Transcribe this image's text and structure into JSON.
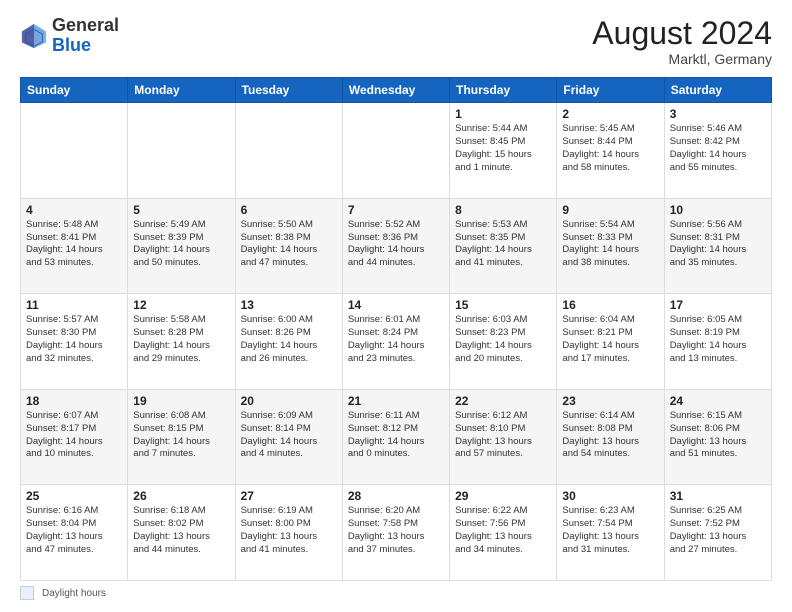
{
  "header": {
    "logo_general": "General",
    "logo_blue": "Blue",
    "month_year": "August 2024",
    "location": "Marktl, Germany"
  },
  "calendar": {
    "days_of_week": [
      "Sunday",
      "Monday",
      "Tuesday",
      "Wednesday",
      "Thursday",
      "Friday",
      "Saturday"
    ],
    "weeks": [
      [
        {
          "day": "",
          "info": ""
        },
        {
          "day": "",
          "info": ""
        },
        {
          "day": "",
          "info": ""
        },
        {
          "day": "",
          "info": ""
        },
        {
          "day": "1",
          "info": "Sunrise: 5:44 AM\nSunset: 8:45 PM\nDaylight: 15 hours\nand 1 minute."
        },
        {
          "day": "2",
          "info": "Sunrise: 5:45 AM\nSunset: 8:44 PM\nDaylight: 14 hours\nand 58 minutes."
        },
        {
          "day": "3",
          "info": "Sunrise: 5:46 AM\nSunset: 8:42 PM\nDaylight: 14 hours\nand 55 minutes."
        }
      ],
      [
        {
          "day": "4",
          "info": "Sunrise: 5:48 AM\nSunset: 8:41 PM\nDaylight: 14 hours\nand 53 minutes."
        },
        {
          "day": "5",
          "info": "Sunrise: 5:49 AM\nSunset: 8:39 PM\nDaylight: 14 hours\nand 50 minutes."
        },
        {
          "day": "6",
          "info": "Sunrise: 5:50 AM\nSunset: 8:38 PM\nDaylight: 14 hours\nand 47 minutes."
        },
        {
          "day": "7",
          "info": "Sunrise: 5:52 AM\nSunset: 8:36 PM\nDaylight: 14 hours\nand 44 minutes."
        },
        {
          "day": "8",
          "info": "Sunrise: 5:53 AM\nSunset: 8:35 PM\nDaylight: 14 hours\nand 41 minutes."
        },
        {
          "day": "9",
          "info": "Sunrise: 5:54 AM\nSunset: 8:33 PM\nDaylight: 14 hours\nand 38 minutes."
        },
        {
          "day": "10",
          "info": "Sunrise: 5:56 AM\nSunset: 8:31 PM\nDaylight: 14 hours\nand 35 minutes."
        }
      ],
      [
        {
          "day": "11",
          "info": "Sunrise: 5:57 AM\nSunset: 8:30 PM\nDaylight: 14 hours\nand 32 minutes."
        },
        {
          "day": "12",
          "info": "Sunrise: 5:58 AM\nSunset: 8:28 PM\nDaylight: 14 hours\nand 29 minutes."
        },
        {
          "day": "13",
          "info": "Sunrise: 6:00 AM\nSunset: 8:26 PM\nDaylight: 14 hours\nand 26 minutes."
        },
        {
          "day": "14",
          "info": "Sunrise: 6:01 AM\nSunset: 8:24 PM\nDaylight: 14 hours\nand 23 minutes."
        },
        {
          "day": "15",
          "info": "Sunrise: 6:03 AM\nSunset: 8:23 PM\nDaylight: 14 hours\nand 20 minutes."
        },
        {
          "day": "16",
          "info": "Sunrise: 6:04 AM\nSunset: 8:21 PM\nDaylight: 14 hours\nand 17 minutes."
        },
        {
          "day": "17",
          "info": "Sunrise: 6:05 AM\nSunset: 8:19 PM\nDaylight: 14 hours\nand 13 minutes."
        }
      ],
      [
        {
          "day": "18",
          "info": "Sunrise: 6:07 AM\nSunset: 8:17 PM\nDaylight: 14 hours\nand 10 minutes."
        },
        {
          "day": "19",
          "info": "Sunrise: 6:08 AM\nSunset: 8:15 PM\nDaylight: 14 hours\nand 7 minutes."
        },
        {
          "day": "20",
          "info": "Sunrise: 6:09 AM\nSunset: 8:14 PM\nDaylight: 14 hours\nand 4 minutes."
        },
        {
          "day": "21",
          "info": "Sunrise: 6:11 AM\nSunset: 8:12 PM\nDaylight: 14 hours\nand 0 minutes."
        },
        {
          "day": "22",
          "info": "Sunrise: 6:12 AM\nSunset: 8:10 PM\nDaylight: 13 hours\nand 57 minutes."
        },
        {
          "day": "23",
          "info": "Sunrise: 6:14 AM\nSunset: 8:08 PM\nDaylight: 13 hours\nand 54 minutes."
        },
        {
          "day": "24",
          "info": "Sunrise: 6:15 AM\nSunset: 8:06 PM\nDaylight: 13 hours\nand 51 minutes."
        }
      ],
      [
        {
          "day": "25",
          "info": "Sunrise: 6:16 AM\nSunset: 8:04 PM\nDaylight: 13 hours\nand 47 minutes."
        },
        {
          "day": "26",
          "info": "Sunrise: 6:18 AM\nSunset: 8:02 PM\nDaylight: 13 hours\nand 44 minutes."
        },
        {
          "day": "27",
          "info": "Sunrise: 6:19 AM\nSunset: 8:00 PM\nDaylight: 13 hours\nand 41 minutes."
        },
        {
          "day": "28",
          "info": "Sunrise: 6:20 AM\nSunset: 7:58 PM\nDaylight: 13 hours\nand 37 minutes."
        },
        {
          "day": "29",
          "info": "Sunrise: 6:22 AM\nSunset: 7:56 PM\nDaylight: 13 hours\nand 34 minutes."
        },
        {
          "day": "30",
          "info": "Sunrise: 6:23 AM\nSunset: 7:54 PM\nDaylight: 13 hours\nand 31 minutes."
        },
        {
          "day": "31",
          "info": "Sunrise: 6:25 AM\nSunset: 7:52 PM\nDaylight: 13 hours\nand 27 minutes."
        }
      ]
    ]
  },
  "footer": {
    "daylight_label": "Daylight hours"
  }
}
